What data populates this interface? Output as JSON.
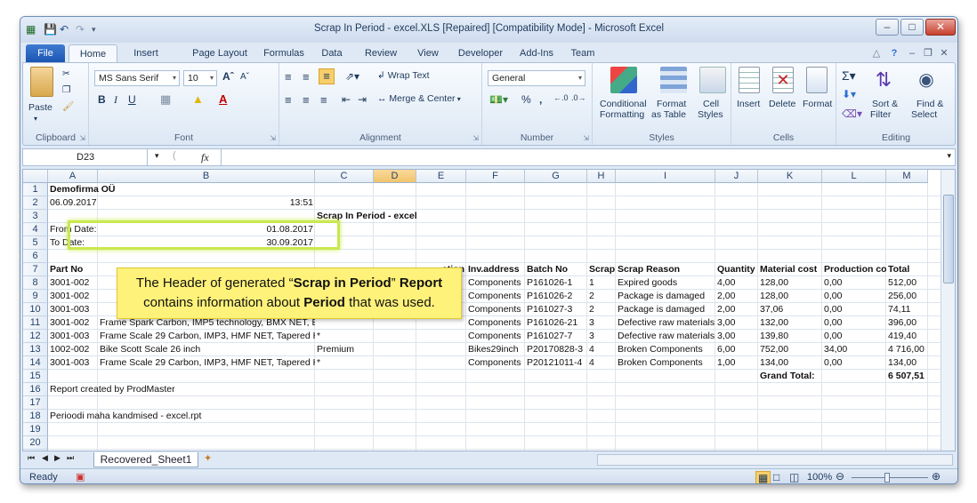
{
  "window": {
    "title": "Scrap In Period - excel.XLS [Repaired]  [Compatibility Mode]  -  Microsoft Excel"
  },
  "ribbon_tabs": [
    "File",
    "Home",
    "Insert",
    "Page Layout",
    "Formulas",
    "Data",
    "Review",
    "View",
    "Developer",
    "Add-Ins",
    "Team"
  ],
  "ribbon": {
    "clipboard": {
      "label": "Clipboard",
      "paste": "Paste"
    },
    "font": {
      "label": "Font",
      "name": "MS Sans Serif",
      "size": "10",
      "bold": "B",
      "italic": "I",
      "underline": "U"
    },
    "alignment": {
      "label": "Alignment",
      "wrap": "Wrap Text",
      "merge": "Merge & Center"
    },
    "number": {
      "label": "Number",
      "format": "General",
      "percent": "%",
      "comma": ","
    },
    "styles": {
      "label": "Styles",
      "conditional": "Conditional",
      "conditional2": "Formatting",
      "format_table": "Format",
      "format_table2": "as Table",
      "cell_styles": "Cell",
      "cell_styles2": "Styles"
    },
    "cells": {
      "label": "Cells",
      "insert": "Insert",
      "delete": "Delete",
      "format": "Format"
    },
    "editing": {
      "label": "Editing",
      "sort": "Sort &",
      "sort2": "Filter",
      "find": "Find &",
      "find2": "Select"
    }
  },
  "formula_bar": {
    "name_box": "D23",
    "fx": "fx",
    "value": ""
  },
  "columns": [
    "A",
    "B",
    "C",
    "D",
    "E",
    "F",
    "G",
    "H",
    "I",
    "J",
    "K",
    "L",
    "M"
  ],
  "selected_column": "D",
  "rows": [
    "1",
    "2",
    "3",
    "4",
    "5",
    "6",
    "7",
    "8",
    "9",
    "10",
    "11",
    "12",
    "13",
    "14",
    "15",
    "16",
    "17",
    "18",
    "19",
    "20",
    "21"
  ],
  "cells": {
    "A1": "Demofirma OÜ",
    "A2": "06.09.2017",
    "B2": "13:51",
    "C3": "Scrap In Period - excel",
    "A4": "From Date:",
    "B4": "01.08.2017",
    "A5": "To Date:",
    "B5": "30.09.2017",
    "A16": "Report created by ProdMaster",
    "A18": "Perioodi maha kandmised - excel.rpt"
  },
  "table": {
    "headers": {
      "A": "Part No",
      "E": "ction",
      "F": "Inv.address",
      "G": "Batch No",
      "H": "Scrap",
      "I": "Scrap Reason",
      "J": "Quantity",
      "K": "Material cost",
      "L": "Production co",
      "M": "Total"
    },
    "rows": [
      {
        "A": "3001-002",
        "B": "",
        "C": "",
        "F": "Components",
        "G": "P161026-1",
        "H": "1",
        "I": "Expired goods",
        "J": "4,00",
        "K": "128,00",
        "L": "0,00",
        "M": "512,00"
      },
      {
        "A": "3001-002",
        "B": "",
        "C": "",
        "F": "Components",
        "G": "P161026-2",
        "H": "2",
        "I": "Package is damaged",
        "J": "2,00",
        "K": "128,00",
        "L": "0,00",
        "M": "256,00"
      },
      {
        "A": "3001-003",
        "B": "",
        "C": "",
        "F": "Components",
        "G": "P161027-3",
        "H": "2",
        "I": "Package is damaged",
        "J": "2,00",
        "K": "37,06",
        "L": "0,00",
        "M": "74,11"
      },
      {
        "A": "3001-002",
        "B": "Frame Spark Carbon, IMP5 technology, BMX NET, BB 4",
        "C": "",
        "F": "Components",
        "G": "P161026-21",
        "H": "3",
        "I": "Defective raw materials",
        "J": "3,00",
        "K": "132,00",
        "L": "0,00",
        "M": "396,00"
      },
      {
        "A": "3001-003",
        "B": "Frame Scale 29 Carbon, IMP3, HMF NET, Tapered HT",
        "C": "*",
        "F": "Components",
        "G": "P161027-7",
        "H": "3",
        "I": "Defective raw materials",
        "J": "3,00",
        "K": "139,80",
        "L": "0,00",
        "M": "419,40"
      },
      {
        "A": "1002-002",
        "B": "Bike Scott Scale 26 inch",
        "C": "Premium",
        "F": "Bikes29inch",
        "G": "P20170828-3",
        "H": "4",
        "I": "Broken Components",
        "J": "6,00",
        "K": "752,00",
        "L": "34,00",
        "M": "4 716,00"
      },
      {
        "A": "3001-003",
        "B": "Frame Scale 29 Carbon, IMP3, HMF NET, Tapered HT",
        "C": "*",
        "F": "Components",
        "G": "P20121011-4",
        "H": "4",
        "I": "Broken Components",
        "J": "1,00",
        "K": "134,00",
        "L": "0,00",
        "M": "134,00"
      }
    ],
    "grand_total_label": "Grand Total:",
    "grand_total_value": "6 507,51"
  },
  "callout": {
    "line1_pre": "The Header of generated “",
    "line1_bold": "Scrap in Period",
    "line1_mid": "” ",
    "line1_bold2": "Report",
    "line2_pre": "contains information about ",
    "line2_bold": "Period",
    "line2_post": " that was used.",
    "color": "#fff27a"
  },
  "sheet_tab": "Recovered_Sheet1",
  "status": {
    "ready": "Ready",
    "zoom": "100%"
  },
  "colors": {
    "accent": "#1c55b3",
    "highlight": "#c9e84f"
  }
}
